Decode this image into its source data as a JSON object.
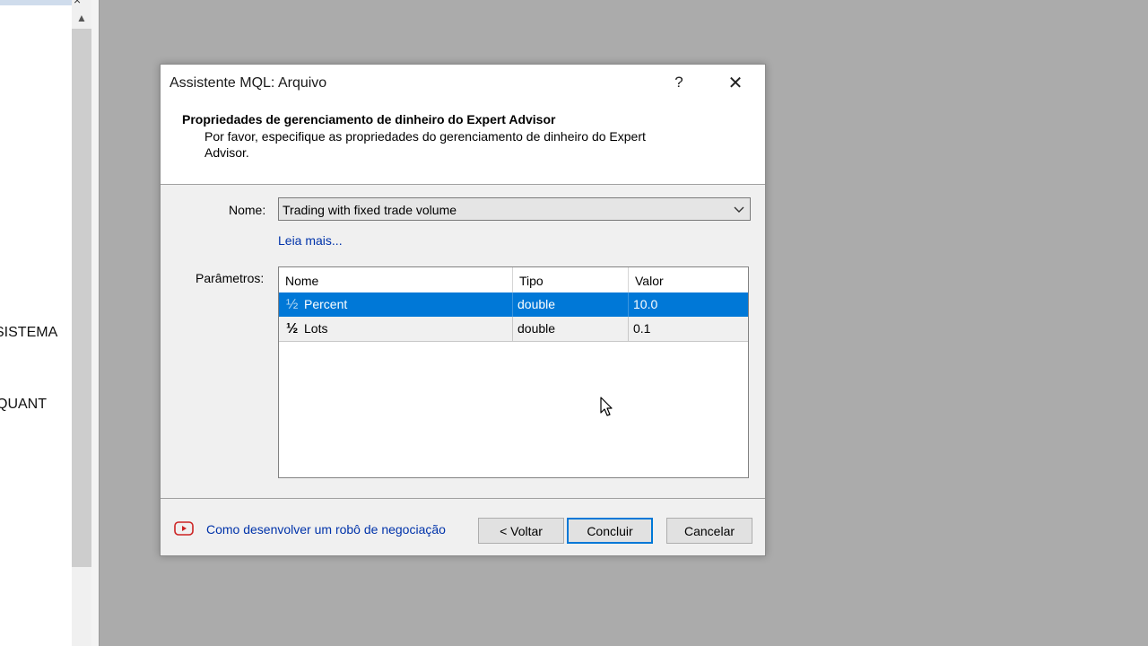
{
  "background": {
    "left_texts": [
      "SISTEMA",
      "QUANT"
    ],
    "close_glyph": "×",
    "scroll_up_glyph": "▲"
  },
  "dialog": {
    "title": "Assistente MQL: Arquivo",
    "help_label": "?",
    "close_label": "✕",
    "header_title": "Propriedades de gerenciamento de dinheiro do Expert Advisor",
    "header_description": "Por favor, especifique as propriedades do gerenciamento de dinheiro do Expert Advisor.",
    "name_label": "Nome:",
    "name_value": "Trading with fixed trade volume",
    "read_more": "Leia mais...",
    "params_label": "Parâmetros:",
    "params_table": {
      "columns": [
        "Nome",
        "Tipo",
        "Valor"
      ],
      "rows": [
        {
          "icon": "½",
          "name": "Percent",
          "type": "double",
          "value": "10.0",
          "selected": true
        },
        {
          "icon": "½",
          "name": "Lots",
          "type": "double",
          "value": "0.1",
          "selected": false
        }
      ]
    },
    "footer_link": "Como desenvolver um robô de negociação",
    "buttons": {
      "back": "< Voltar",
      "finish": "Concluir",
      "cancel": "Cancelar"
    }
  },
  "colors": {
    "selection": "#0078d7",
    "link": "#0033aa",
    "youtube": "#cc2222"
  }
}
